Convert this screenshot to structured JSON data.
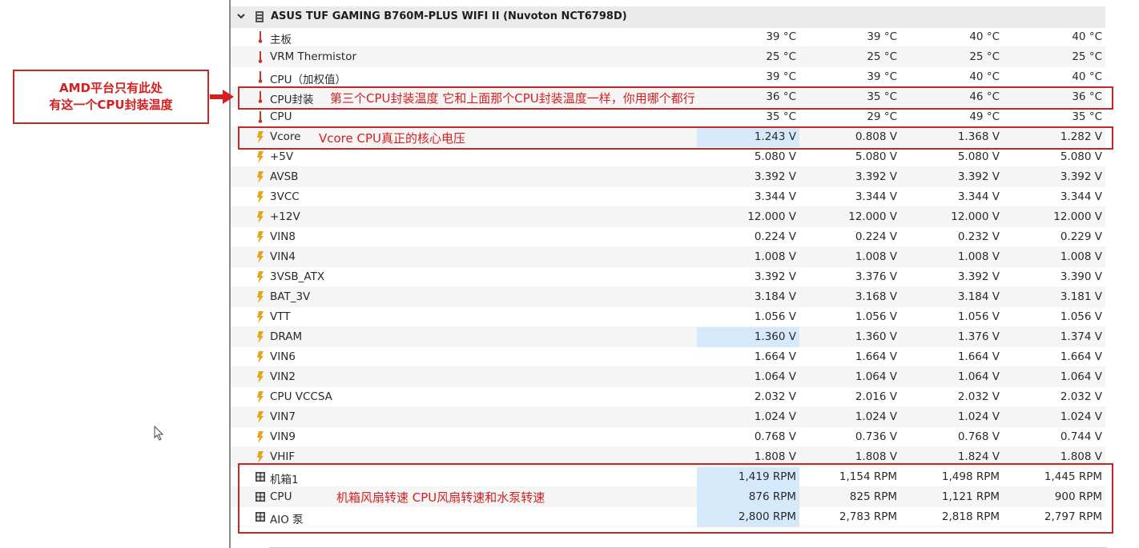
{
  "header": {
    "title": "ASUS TUF GAMING B760M-PLUS WIFI II (Nuvoton NCT6798D)",
    "icon": "chip-icon",
    "expand_icon": "chevron-down-icon"
  },
  "sensors": [
    {
      "label": "主板",
      "icon": "thermometer-icon",
      "v": [
        "39 °C",
        "39 °C",
        "40 °C",
        "40 °C"
      ]
    },
    {
      "label": "VRM Thermistor",
      "icon": "thermometer-icon",
      "v": [
        "25 °C",
        "25 °C",
        "25 °C",
        "25 °C"
      ]
    },
    {
      "label": "CPU（加权值）",
      "icon": "thermometer-icon",
      "v": [
        "39 °C",
        "39 °C",
        "40 °C",
        "40 °C"
      ]
    },
    {
      "label": "CPU封装",
      "icon": "thermometer-icon",
      "v": [
        "36 °C",
        "35 °C",
        "46 °C",
        "36 °C"
      ]
    },
    {
      "label": "CPU",
      "icon": "thermometer-icon",
      "v": [
        "35 °C",
        "29 °C",
        "49 °C",
        "35 °C"
      ]
    },
    {
      "label": "Vcore",
      "icon": "voltage-icon",
      "v": [
        "1.243 V",
        "0.808 V",
        "1.368 V",
        "1.282 V"
      ],
      "highlight": true
    },
    {
      "label": "+5V",
      "icon": "voltage-icon",
      "v": [
        "5.080 V",
        "5.080 V",
        "5.080 V",
        "5.080 V"
      ]
    },
    {
      "label": "AVSB",
      "icon": "voltage-icon",
      "v": [
        "3.392 V",
        "3.392 V",
        "3.392 V",
        "3.392 V"
      ]
    },
    {
      "label": "3VCC",
      "icon": "voltage-icon",
      "v": [
        "3.344 V",
        "3.344 V",
        "3.344 V",
        "3.344 V"
      ]
    },
    {
      "label": "+12V",
      "icon": "voltage-icon",
      "v": [
        "12.000 V",
        "12.000 V",
        "12.000 V",
        "12.000 V"
      ]
    },
    {
      "label": "VIN8",
      "icon": "voltage-icon",
      "v": [
        "0.224 V",
        "0.224 V",
        "0.232 V",
        "0.229 V"
      ]
    },
    {
      "label": "VIN4",
      "icon": "voltage-icon",
      "v": [
        "1.008 V",
        "1.008 V",
        "1.008 V",
        "1.008 V"
      ]
    },
    {
      "label": "3VSB_ATX",
      "icon": "voltage-icon",
      "v": [
        "3.392 V",
        "3.376 V",
        "3.392 V",
        "3.390 V"
      ]
    },
    {
      "label": "BAT_3V",
      "icon": "voltage-icon",
      "v": [
        "3.184 V",
        "3.168 V",
        "3.184 V",
        "3.181 V"
      ]
    },
    {
      "label": "VTT",
      "icon": "voltage-icon",
      "v": [
        "1.056 V",
        "1.056 V",
        "1.056 V",
        "1.056 V"
      ]
    },
    {
      "label": "DRAM",
      "icon": "voltage-icon",
      "v": [
        "1.360 V",
        "1.360 V",
        "1.376 V",
        "1.374 V"
      ],
      "highlight": true
    },
    {
      "label": "VIN6",
      "icon": "voltage-icon",
      "v": [
        "1.664 V",
        "1.664 V",
        "1.664 V",
        "1.664 V"
      ]
    },
    {
      "label": "VIN2",
      "icon": "voltage-icon",
      "v": [
        "1.064 V",
        "1.064 V",
        "1.064 V",
        "1.064 V"
      ]
    },
    {
      "label": "CPU VCCSA",
      "icon": "voltage-icon",
      "v": [
        "2.032 V",
        "2.016 V",
        "2.032 V",
        "2.032 V"
      ]
    },
    {
      "label": "VIN7",
      "icon": "voltage-icon",
      "v": [
        "1.024 V",
        "1.024 V",
        "1.024 V",
        "1.024 V"
      ]
    },
    {
      "label": "VIN9",
      "icon": "voltage-icon",
      "v": [
        "0.768 V",
        "0.736 V",
        "0.768 V",
        "0.744 V"
      ]
    },
    {
      "label": "VHIF",
      "icon": "voltage-icon",
      "v": [
        "1.808 V",
        "1.808 V",
        "1.824 V",
        "1.808 V"
      ]
    },
    {
      "label": "机箱1",
      "icon": "fan-icon",
      "v": [
        "1,419 RPM",
        "1,154 RPM",
        "1,498 RPM",
        "1,445 RPM"
      ],
      "highlight": true
    },
    {
      "label": "CPU",
      "icon": "fan-icon",
      "v": [
        "876 RPM",
        "825 RPM",
        "1,121 RPM",
        "900 RPM"
      ],
      "highlight": true
    },
    {
      "label": "AIO 泵",
      "icon": "fan-icon",
      "v": [
        "2,800 RPM",
        "2,783 RPM",
        "2,818 RPM",
        "2,797 RPM"
      ],
      "highlight": true
    }
  ],
  "annotations": {
    "note_line1": "AMD平台只有此处",
    "note_line2": "有这一个CPU封装温度",
    "package_note": "第三个CPU封装温度 它和上面那个CPU封装温度一样，你用哪个都行",
    "vcore_note": "Vcore  CPU真正的核心电压",
    "fan_note": "机箱风扇转速 CPU风扇转速和水泵转速"
  },
  "colors": {
    "annotation_red": "#c62626",
    "highlight_blue": "#d5e9fb",
    "voltage_icon": "#e3a51a",
    "thermometer_icon": "#c0392b"
  }
}
